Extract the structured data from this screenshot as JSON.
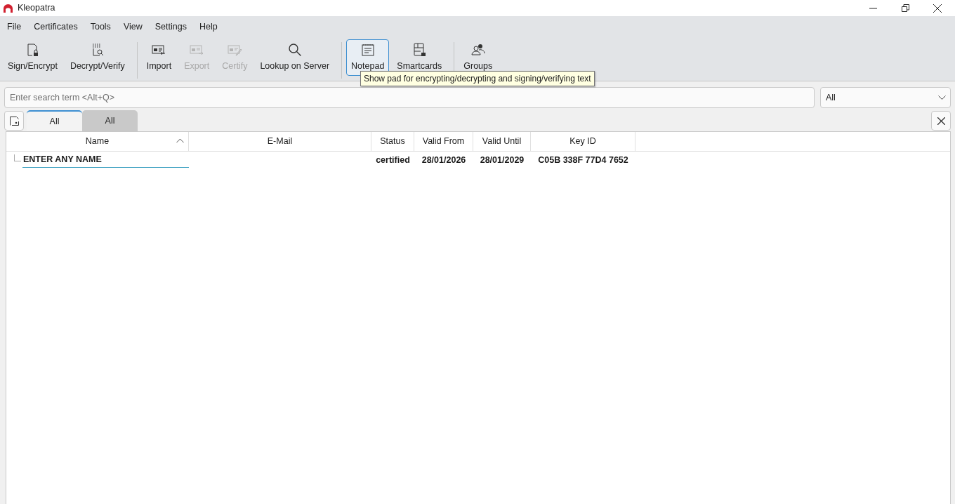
{
  "window": {
    "title": "Kleopatra"
  },
  "menu": [
    "File",
    "Certificates",
    "Tools",
    "View",
    "Settings",
    "Help"
  ],
  "toolbar": [
    {
      "buttons": [
        {
          "kind": "sign",
          "label": "Sign/Encrypt",
          "disabled": false,
          "active": false
        },
        {
          "kind": "decrypt",
          "label": "Decrypt/Verify",
          "disabled": false,
          "active": false
        }
      ]
    },
    {
      "buttons": [
        {
          "kind": "import",
          "label": "Import",
          "disabled": false,
          "active": false
        },
        {
          "kind": "export",
          "label": "Export",
          "disabled": true,
          "active": false
        },
        {
          "kind": "certify",
          "label": "Certify",
          "disabled": true,
          "active": false
        },
        {
          "kind": "lookup",
          "label": "Lookup on Server",
          "disabled": false,
          "active": false
        }
      ]
    },
    {
      "buttons": [
        {
          "kind": "notepad",
          "label": "Notepad",
          "disabled": false,
          "active": true
        },
        {
          "kind": "smartcards",
          "label": "Smartcards",
          "disabled": false,
          "active": false
        }
      ]
    },
    {
      "buttons": [
        {
          "kind": "groups",
          "label": "Groups",
          "disabled": false,
          "active": false
        }
      ]
    }
  ],
  "tooltip": "Show pad for encrypting/decrypting and signing/verifying text",
  "search": {
    "placeholder": "Enter search term <Alt+Q>"
  },
  "filter": {
    "value": "All"
  },
  "tabs": [
    {
      "label": "All",
      "selected": true
    },
    {
      "label": "All",
      "selected": false
    }
  ],
  "table": {
    "columns": [
      {
        "label": "Name",
        "sorted": true
      },
      {
        "label": "E-Mail",
        "sorted": false
      },
      {
        "label": "Status",
        "sorted": false
      },
      {
        "label": "Valid From",
        "sorted": false
      },
      {
        "label": "Valid Until",
        "sorted": false
      },
      {
        "label": "Key ID",
        "sorted": false
      }
    ],
    "rows": [
      {
        "cells": [
          "ENTER ANY NAME",
          "",
          "certified",
          "28/01/2026",
          "28/01/2029",
          "C05B 338F 77D4 7652"
        ],
        "current": true
      }
    ]
  }
}
